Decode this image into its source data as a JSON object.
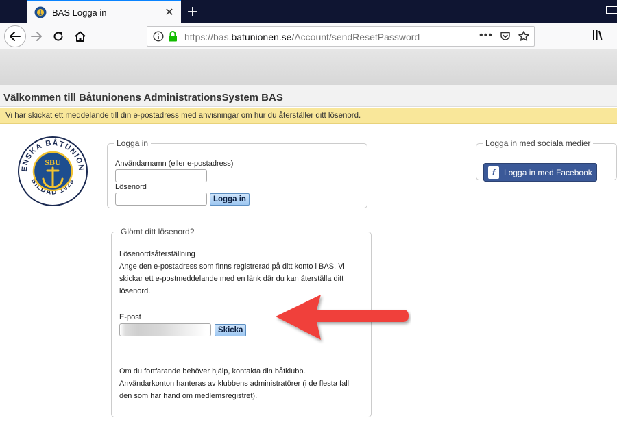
{
  "browser": {
    "tab_title": "BAS Logga in",
    "tab_close_glyph": "✕",
    "new_tab_glyph": "+",
    "url_prefix": "https://bas.",
    "url_host": "batunionen.se",
    "url_path": "/Account/sendResetPassword",
    "url_more_glyph": "•••"
  },
  "page": {
    "title": "Välkommen till Båtunionens AdministrationsSystem BAS",
    "notice": "Vi har skickat ett meddelande till din e-postadress med anvisningar om hur du återställer ditt lösenord.",
    "notice_color": "#f9e79a"
  },
  "logo": {
    "ring_text": "SVENSKA BÅTUNIONEN",
    "bottom_text": "BILDAD 1928",
    "center_text": "SBU"
  },
  "login": {
    "legend": "Logga in",
    "username_label": "Användarnamn (eller e-postadress)",
    "password_label": "Lösenord",
    "submit_label": "Logga in"
  },
  "social": {
    "legend": "Logga in med sociala medier",
    "facebook_label": "Logga in med Facebook",
    "facebook_color": "#3b5998"
  },
  "forgot": {
    "legend": "Glömt ditt lösenord?",
    "heading": "Lösenordsåterställning",
    "description": "Ange den e-postadress som finns registrerad på ditt konto i BAS. Vi skickar ett e-postmeddelande med en länk där du kan återställa ditt lösenord.",
    "email_label": "E-post",
    "submit_label": "Skicka",
    "help_text": "Om du fortfarande behöver hjälp, kontakta din båtklubb. Användarkonton hanteras av klubbens administratörer (i de flesta fall den som har hand om medlemsregistret)."
  },
  "annotation": {
    "arrow_color": "#f0403a"
  }
}
